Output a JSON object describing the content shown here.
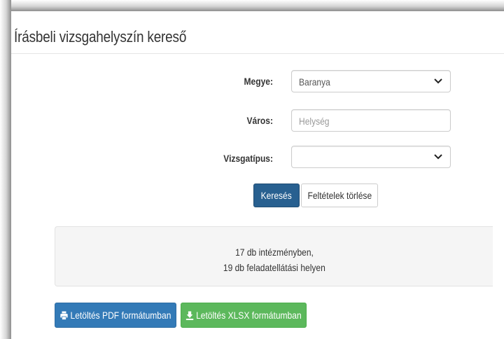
{
  "page": {
    "title": "Írásbeli vizsgahelyszín kereső"
  },
  "form": {
    "county": {
      "label": "Megye:",
      "value": "Baranya"
    },
    "city": {
      "label": "Város:",
      "placeholder": "Helység",
      "value": ""
    },
    "exam_type": {
      "label": "Vizsgatípus:",
      "value": ""
    },
    "search_button": "Keresés",
    "clear_button": "Feltételek törlése"
  },
  "results": {
    "line1": "17 db intézményben,",
    "line2": "19 db feladatellátási helyen"
  },
  "downloads": {
    "pdf_label": "Letöltés PDF formátumban",
    "xlsx_label": "Letöltés XLSX formátumban",
    "pdf_icon": "print-icon",
    "xlsx_icon": "download-icon"
  },
  "colors": {
    "primary": "#286090",
    "pdf": "#337ab7",
    "xlsx": "#5cb85c"
  }
}
